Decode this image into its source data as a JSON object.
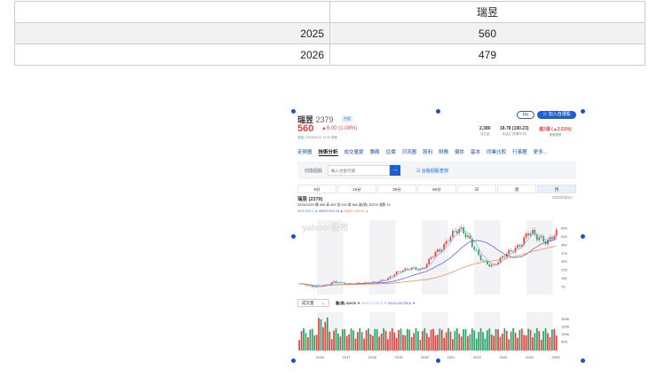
{
  "table": {
    "header": [
      "",
      "瑞昱"
    ],
    "rows": [
      [
        "2025",
        "560"
      ],
      [
        "2026",
        "479"
      ]
    ]
  },
  "stock": {
    "name": "瑞昱",
    "code": "2379",
    "badge": "台股",
    "price": "560",
    "change": "▲6.00 (1.08%)",
    "time": "收盤 | 2025/03/21 13:30 更新",
    "pk": "PK",
    "watch": "加入自選股",
    "stats": [
      {
        "v": "2,380",
        "l": "成交量"
      },
      {
        "v": "18.78 (190.23)",
        "l": "本益比 (同業平均)"
      },
      {
        "v": "連2漲 (▲3.51%)",
        "l": "連漲連跌"
      }
    ]
  },
  "tabs": [
    "走勢圖",
    "技術分析",
    "成交量變",
    "籌碼",
    "估價",
    "河流圖",
    "股利",
    "財務",
    "健診",
    "基本",
    "同業比較",
    "行事曆",
    "更多..."
  ],
  "switch": {
    "label": "切換個股",
    "placeholder": "輸入台股代號",
    "link": "台股個股查詢"
  },
  "periods": [
    "5分",
    "10分",
    "30分",
    "60分",
    "日",
    "週",
    "月"
  ],
  "chart": {
    "title": "瑞昱 (2379)",
    "date": "2025/03/21",
    "ohlc": "2025/03/20    開 556  高 563  低 534  收 560  量(張) 32978  漲跌 10",
    "ma5": "MA5 539.2 ▲",
    "ma20": "MA20 501.18 ▲",
    "ma60": "MA60 439.62 ▲",
    "vol_select": "成交量",
    "vol_info": "量(張) 32978 ▼",
    "vol_ma5": "MV5 47125.6 ▼",
    "vol_ma20": "MV20 60798.8 ▼",
    "watermark": "yahoo!股市"
  },
  "chart_data": {
    "type": "candlestick",
    "y_ticks": [
      600,
      525,
      450,
      375,
      300,
      225,
      150,
      75
    ],
    "vol_ticks": [
      "200K",
      "150K",
      "100K",
      "50K"
    ],
    "x_ticks": [
      "2016",
      "2017",
      "2018",
      "2019",
      "2020",
      "2021",
      "2022",
      "2023",
      "2024",
      "2025"
    ],
    "closes": [
      100,
      95,
      80,
      70,
      75,
      85,
      95,
      120,
      110,
      105,
      100,
      100,
      105,
      105,
      110,
      112,
      118,
      130,
      140,
      170,
      200,
      215,
      230,
      240,
      235,
      225,
      260,
      330,
      380,
      400,
      450,
      520,
      570,
      590,
      560,
      500,
      420,
      350,
      300,
      270,
      260,
      300,
      350,
      380,
      400,
      430,
      470,
      560,
      560,
      520,
      500,
      470,
      520,
      560
    ],
    "colors": {
      "up": "#e8413b",
      "down": "#29a36a",
      "ma5": "#7fb3e6",
      "ma20": "#5a4fcf",
      "ma60": "#e0874a",
      "accent": "#1a5fd6"
    }
  }
}
